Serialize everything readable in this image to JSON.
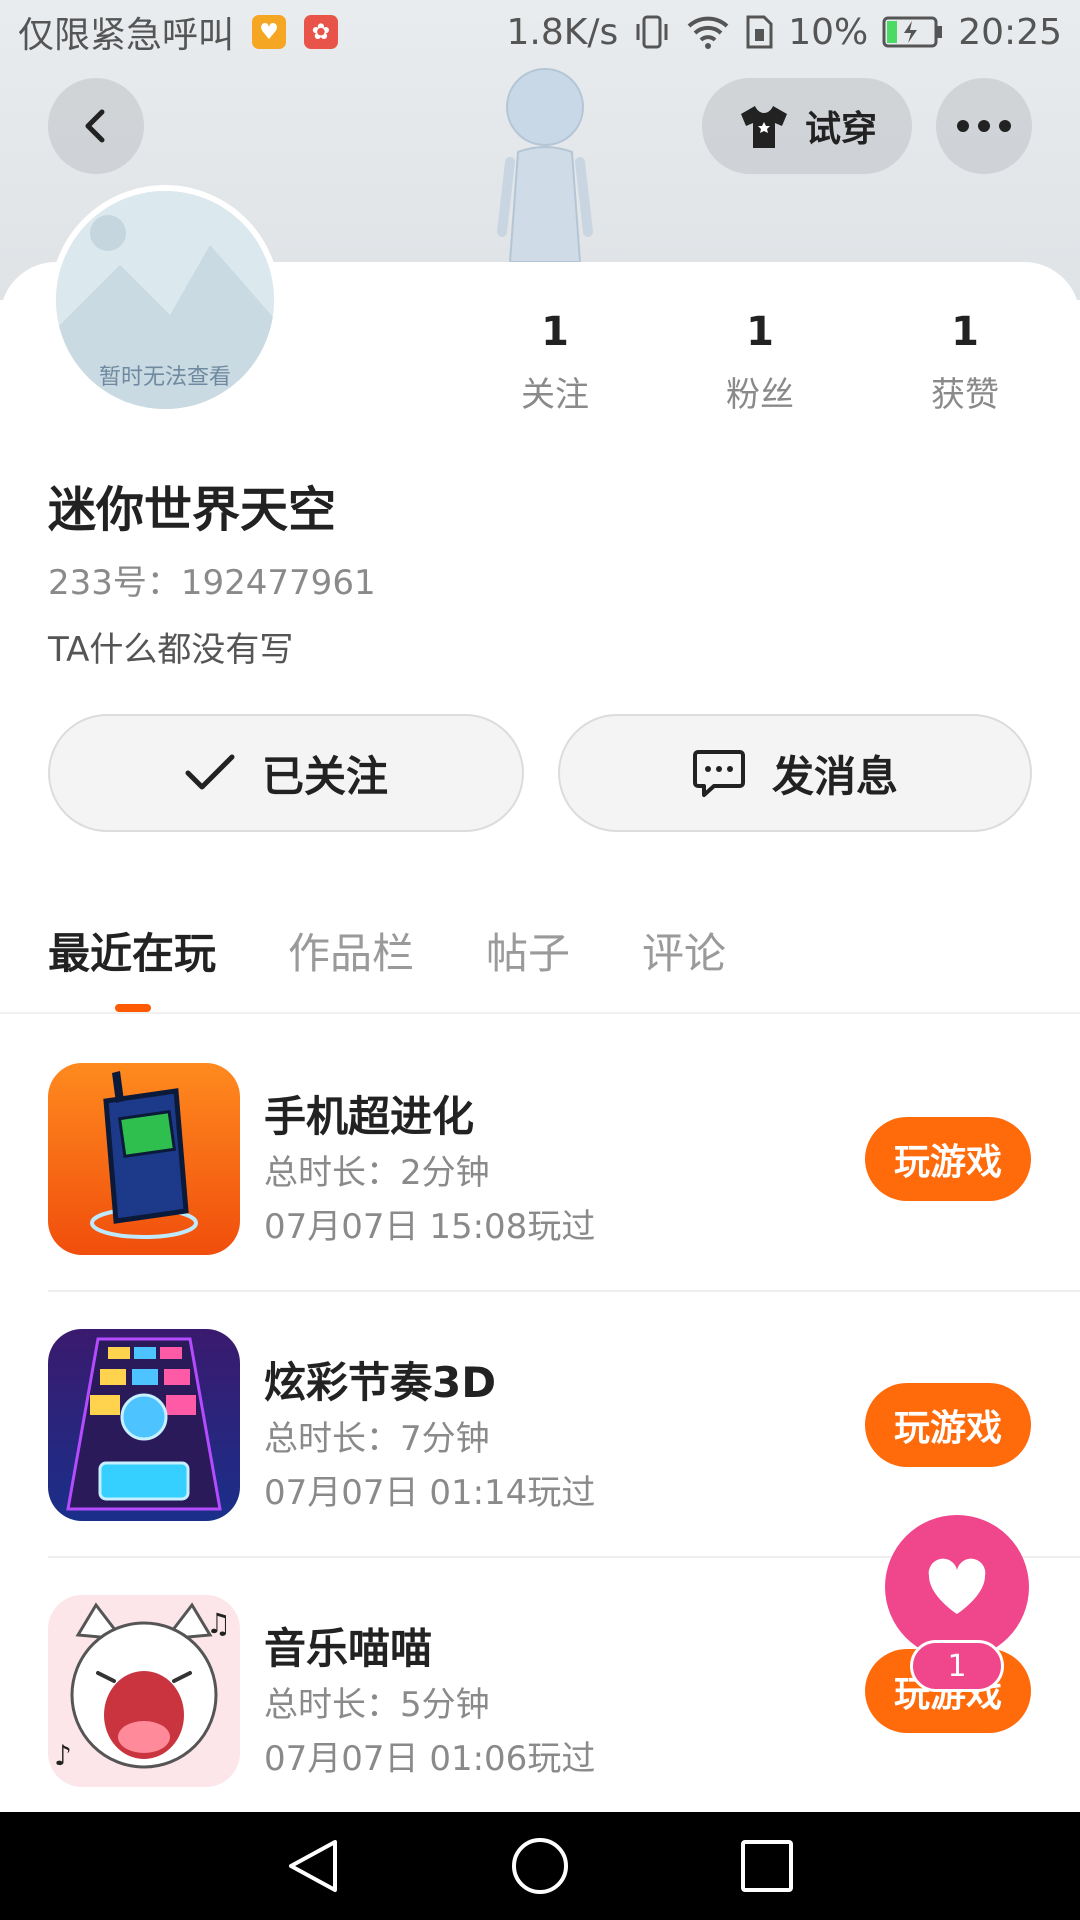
{
  "status_bar": {
    "carrier": "仅限紧急呼叫",
    "speed": "1.8K/s",
    "battery": "10%",
    "time": "20:25"
  },
  "header": {
    "tryon_label": "试穿"
  },
  "avatar": {
    "placeholder_text": "暂时无法查看"
  },
  "stats": [
    {
      "value": "1",
      "label": "关注"
    },
    {
      "value": "1",
      "label": "粉丝"
    },
    {
      "value": "1",
      "label": "获赞"
    }
  ],
  "profile": {
    "nickname": "迷你世界天空",
    "uid": "233号：192477961",
    "bio": "TA什么都没有写"
  },
  "actions": {
    "follow_label": "已关注",
    "message_label": "发消息"
  },
  "tabs": [
    {
      "label": "最近在玩",
      "active": true
    },
    {
      "label": "作品栏",
      "active": false
    },
    {
      "label": "帖子",
      "active": false
    },
    {
      "label": "评论",
      "active": false
    }
  ],
  "games": [
    {
      "title": "手机超进化",
      "duration": "总时长：2分钟",
      "last_played": "07月07日 15:08玩过",
      "button": "玩游戏"
    },
    {
      "title": "炫彩节奏3D",
      "duration": "总时长：7分钟",
      "last_played": "07月07日 01:14玩过",
      "button": "玩游戏"
    },
    {
      "title": "音乐喵喵",
      "duration": "总时长：5分钟",
      "last_played": "07月07日 01:06玩过",
      "button": "玩游戏"
    }
  ],
  "like_fab": {
    "count": "1"
  },
  "colors": {
    "accent": "#ff6a0a",
    "tab_indicator": "#ff5a00",
    "like": "#f0468c"
  }
}
